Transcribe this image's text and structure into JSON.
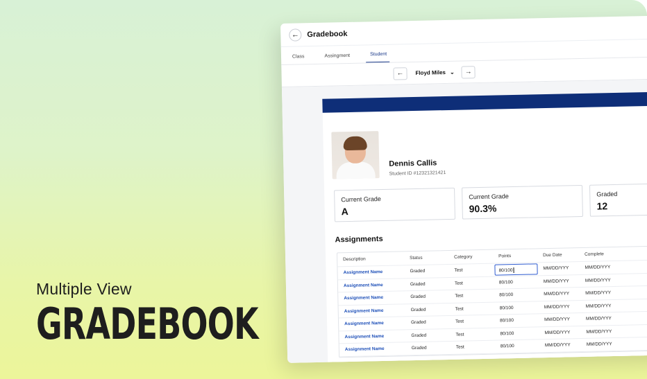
{
  "promo": {
    "subtitle": "Multiple View",
    "title": "GRADEBOOK"
  },
  "app": {
    "title": "Gradebook",
    "back_icon": "arrow-left-icon"
  },
  "tabs": [
    {
      "label": "Class",
      "active": false
    },
    {
      "label": "Assingment",
      "active": false
    },
    {
      "label": "Student",
      "active": true
    }
  ],
  "student_nav": {
    "selected_student": "Floyd Miles",
    "prev_icon": "arrow-left-icon",
    "next_icon": "arrow-right-icon"
  },
  "colors": {
    "accent": "#0e2e78",
    "link": "#1d4fb8"
  },
  "profile": {
    "name": "Dennis Callis",
    "student_id": "Student ID #12321321421"
  },
  "stats": [
    {
      "label": "Current Grade",
      "value": "A"
    },
    {
      "label": "Current Grade",
      "value": "90.3%"
    },
    {
      "label": "Graded",
      "value": "12"
    }
  ],
  "assignments": {
    "title": "Assignments",
    "columns": [
      "Description",
      "Status",
      "Category",
      "Points",
      "Due Date",
      "Complete"
    ],
    "rows": [
      {
        "description": "Assignment Name",
        "status": "Graded",
        "category": "Test",
        "points": "80/100",
        "due": "MM/DD/YYY",
        "complete": "MM/DD/YYY"
      },
      {
        "description": "Assignment Name",
        "status": "Graded",
        "category": "Test",
        "points": "80/100",
        "due": "MM/DD/YYY",
        "complete": "MM/DD/YYY"
      },
      {
        "description": "Assignment Name",
        "status": "Graded",
        "category": "Test",
        "points": "80/100",
        "due": "MM/DD/YYY",
        "complete": "MM/DD/YYY"
      },
      {
        "description": "Assignment Name",
        "status": "Graded",
        "category": "Test",
        "points": "80/100",
        "due": "MM/DD/YYY",
        "complete": "MM/DD/YYY"
      },
      {
        "description": "Assignment Name",
        "status": "Graded",
        "category": "Test",
        "points": "80/100",
        "due": "MM/DD/YYY",
        "complete": "MM/DD/YYY"
      },
      {
        "description": "Assignment Name",
        "status": "Graded",
        "category": "Test",
        "points": "80/100",
        "due": "MM/DD/YYY",
        "complete": "MM/DD/YYY"
      },
      {
        "description": "Assignment Name",
        "status": "Graded",
        "category": "Test",
        "points": "80/100",
        "due": "MM/DD/YYY",
        "complete": "MM/DD/YYY"
      }
    ]
  }
}
